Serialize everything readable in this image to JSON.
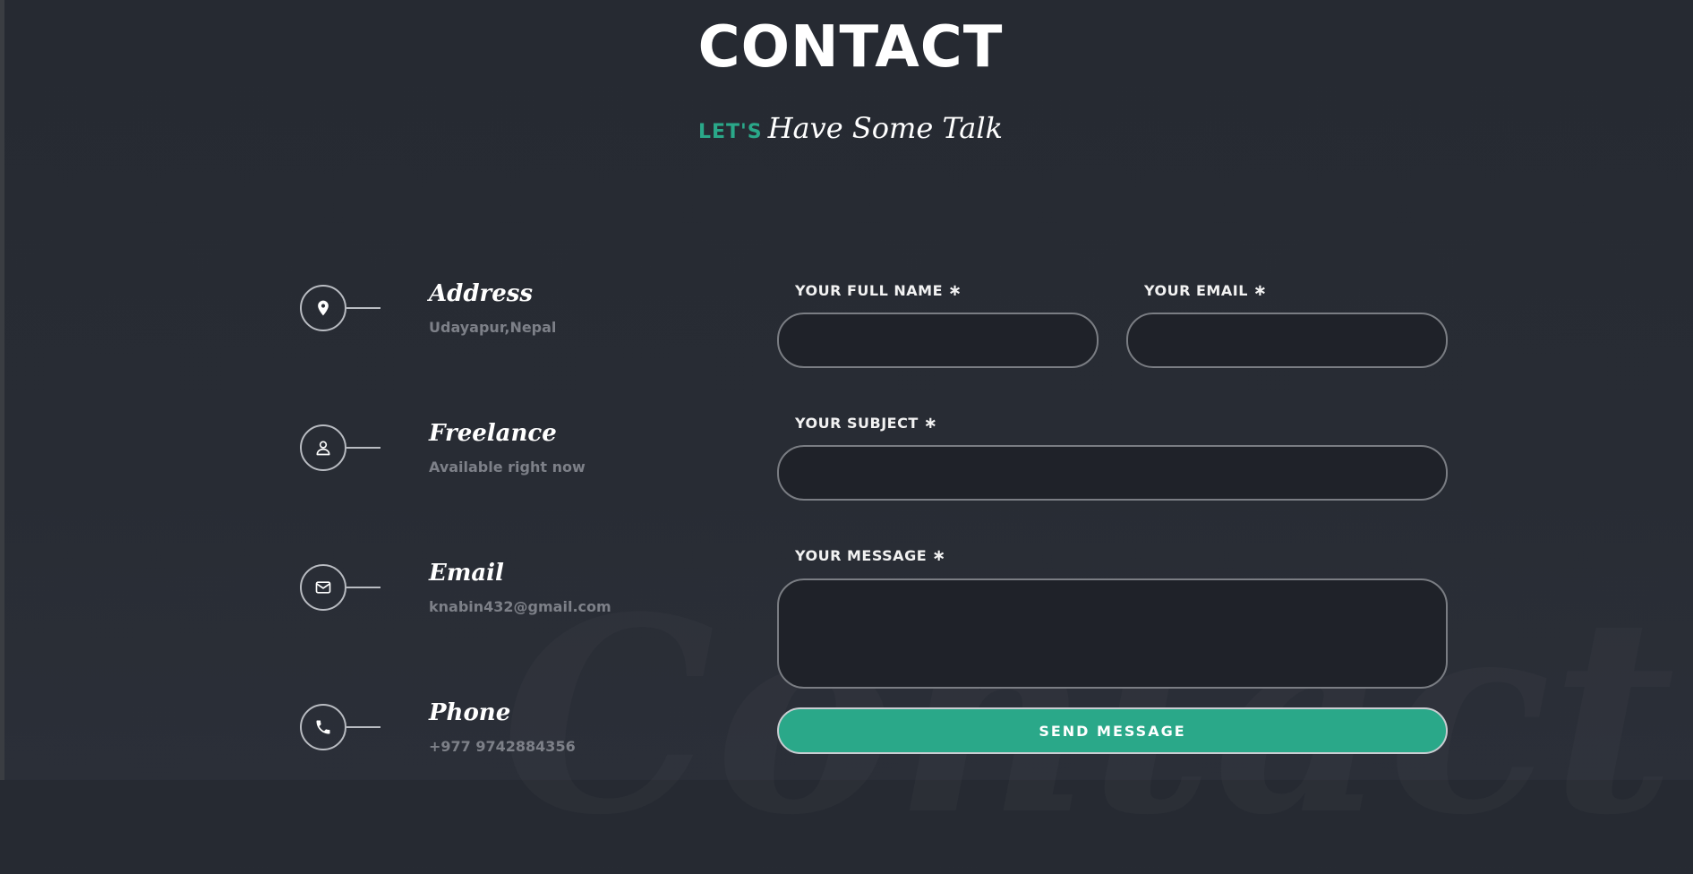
{
  "section": {
    "title": "CONTACT",
    "subtitle_prefix": "LET'S",
    "subtitle_script": "Have Some Talk",
    "watermark": "Contact"
  },
  "info": {
    "items": [
      {
        "icon": "location-pin-icon",
        "title": "Address",
        "value": "Udayapur,Nepal"
      },
      {
        "icon": "user-icon",
        "title": "Freelance",
        "value": "Available right now"
      },
      {
        "icon": "mail-icon",
        "title": "Email",
        "value": "knabin432@gmail.com"
      },
      {
        "icon": "phone-icon",
        "title": "Phone",
        "value": "+977 9742884356"
      }
    ]
  },
  "form": {
    "name_label": "YOUR FULL NAME",
    "email_label": "YOUR EMAIL",
    "subject_label": "YOUR SUBJECT",
    "message_label": "YOUR MESSAGE",
    "required_mark": "∗",
    "name_value": "",
    "email_value": "",
    "subject_value": "",
    "message_value": "",
    "submit_label": "SEND MESSAGE"
  },
  "colors": {
    "accent": "#2aa889",
    "background": "#282c34",
    "field_background": "#1f2229",
    "muted_text": "#7d8088"
  }
}
